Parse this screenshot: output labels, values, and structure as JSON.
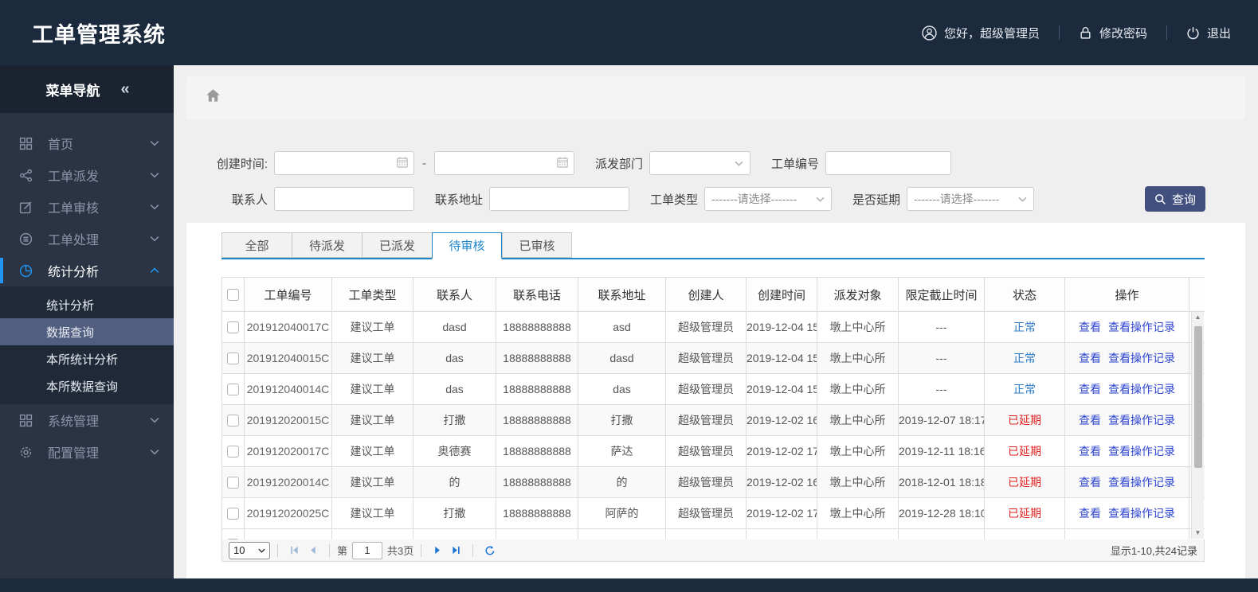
{
  "header": {
    "title": "工单管理系统",
    "greeting": "您好，超级管理员",
    "change_password": "修改密码",
    "logout": "退出"
  },
  "sidebar": {
    "title": "菜单导航",
    "collapse": "«",
    "items_top": [
      {
        "label": "首页",
        "icon": "grid"
      },
      {
        "label": "工单派发",
        "icon": "share"
      },
      {
        "label": "工单审核",
        "icon": "edit"
      },
      {
        "label": "工单处理",
        "icon": "layers"
      },
      {
        "label": "统计分析",
        "icon": "pie",
        "active": true
      }
    ],
    "submenu": [
      {
        "label": "统计分析",
        "selected": false
      },
      {
        "label": "数据查询",
        "selected": true
      },
      {
        "label": "本所统计分析",
        "selected": false
      },
      {
        "label": "本所数据查询",
        "selected": false
      }
    ],
    "items_bottom": [
      {
        "label": "系统管理",
        "icon": "grid"
      },
      {
        "label": "配置管理",
        "icon": "gear"
      }
    ]
  },
  "filters": {
    "created_label": "创建时间:",
    "range_sep": "-",
    "dept_label": "派发部门",
    "order_no_label": "工单编号",
    "contact_label": "联系人",
    "address_label": "联系地址",
    "type_label": "工单类型",
    "delay_label": "是否延期",
    "select_placeholder": "-------请选择-------",
    "search_label": "查询"
  },
  "tabs": [
    {
      "label": "全部",
      "active": false
    },
    {
      "label": "待派发",
      "active": false
    },
    {
      "label": "已派发",
      "active": false
    },
    {
      "label": "待审核",
      "active": true
    },
    {
      "label": "已审核",
      "active": false
    }
  ],
  "table": {
    "columns": [
      "工单编号",
      "工单类型",
      "联系人",
      "联系电话",
      "联系地址",
      "创建人",
      "创建时间",
      "派发对象",
      "限定截止时间",
      "状态",
      "操作"
    ],
    "action_labels": [
      "查看",
      "查看操作记录"
    ],
    "rows": [
      {
        "no": "201912040017C",
        "type": "建议工单",
        "contact": "dasd",
        "phone": "18888888888",
        "addr": "asd",
        "creator": "超级管理员",
        "created": "2019-12-04 15",
        "target": "墩上中心所",
        "deadline": "---",
        "status": "正常"
      },
      {
        "no": "201912040015C",
        "type": "建议工单",
        "contact": "das",
        "phone": "18888888888",
        "addr": "dasd",
        "creator": "超级管理员",
        "created": "2019-12-04 15",
        "target": "墩上中心所",
        "deadline": "---",
        "status": "正常"
      },
      {
        "no": "201912040014C",
        "type": "建议工单",
        "contact": "das",
        "phone": "18888888888",
        "addr": "das",
        "creator": "超级管理员",
        "created": "2019-12-04 15",
        "target": "墩上中心所",
        "deadline": "---",
        "status": "正常"
      },
      {
        "no": "201912020015C",
        "type": "建议工单",
        "contact": "打撒",
        "phone": "18888888888",
        "addr": "打撒",
        "creator": "超级管理员",
        "created": "2019-12-02 16",
        "target": "墩上中心所",
        "deadline": "2019-12-07 18:17",
        "status": "已延期"
      },
      {
        "no": "201912020017C",
        "type": "建议工单",
        "contact": "奥德赛",
        "phone": "18888888888",
        "addr": "萨达",
        "creator": "超级管理员",
        "created": "2019-12-02 17",
        "target": "墩上中心所",
        "deadline": "2019-12-11 18:16",
        "status": "已延期"
      },
      {
        "no": "201912020014C",
        "type": "建议工单",
        "contact": "的",
        "phone": "18888888888",
        "addr": "的",
        "creator": "超级管理员",
        "created": "2019-12-02 16",
        "target": "墩上中心所",
        "deadline": "2018-12-01 18:18",
        "status": "已延期"
      },
      {
        "no": "201912020025C",
        "type": "建议工单",
        "contact": "打撒",
        "phone": "18888888888",
        "addr": "阿萨的",
        "creator": "超级管理员",
        "created": "2019-12-02 17",
        "target": "墩上中心所",
        "deadline": "2019-12-28 18:10",
        "status": "已延期"
      }
    ]
  },
  "pagination": {
    "page_size": "10",
    "page_prefix": "第",
    "current_page": "1",
    "total_pages": "共3页",
    "summary": "显示1-10,共24记录"
  },
  "colors": {
    "header_bg": "#1c2a3e",
    "sidebar_bg": "#2a3445",
    "accent_blue": "#2196f3",
    "submenu_selected": "#515e80",
    "search_button": "#41507e",
    "tab_active": "#1f86c8",
    "link_blue": "#2f46d0",
    "status_normal": "#2d7bc4",
    "status_overdue": "#e01f1f"
  }
}
